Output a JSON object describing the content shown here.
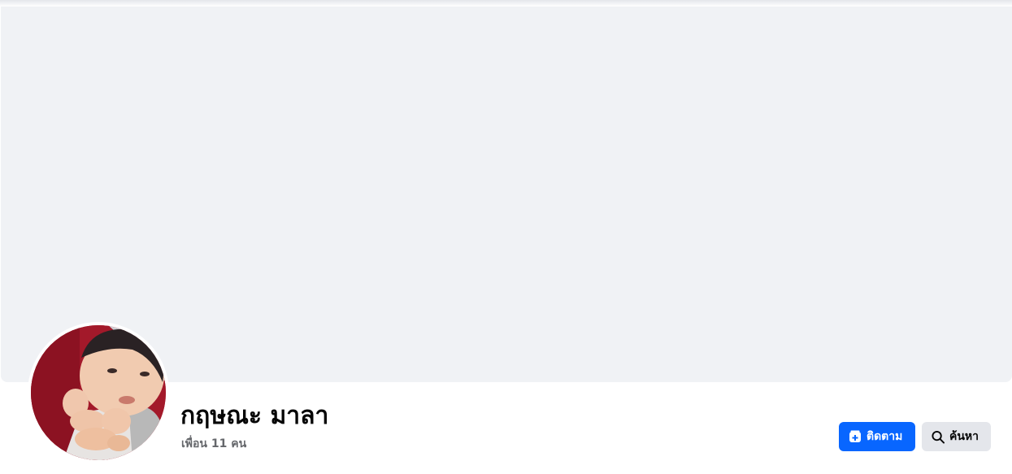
{
  "profile": {
    "name": "กฤษณะ มาลา",
    "friends_count_text": "เพื่อน 11 คน"
  },
  "actions": {
    "follow_label": "ติดตาม",
    "search_label": "ค้นหา"
  },
  "icons": {
    "follow": "follow-plus-icon",
    "search": "search-icon"
  },
  "colors": {
    "primary": "#0866ff",
    "secondary_button": "#e4e6eb",
    "cover_background": "#f0f2f5",
    "secondary_text": "#65676b"
  }
}
